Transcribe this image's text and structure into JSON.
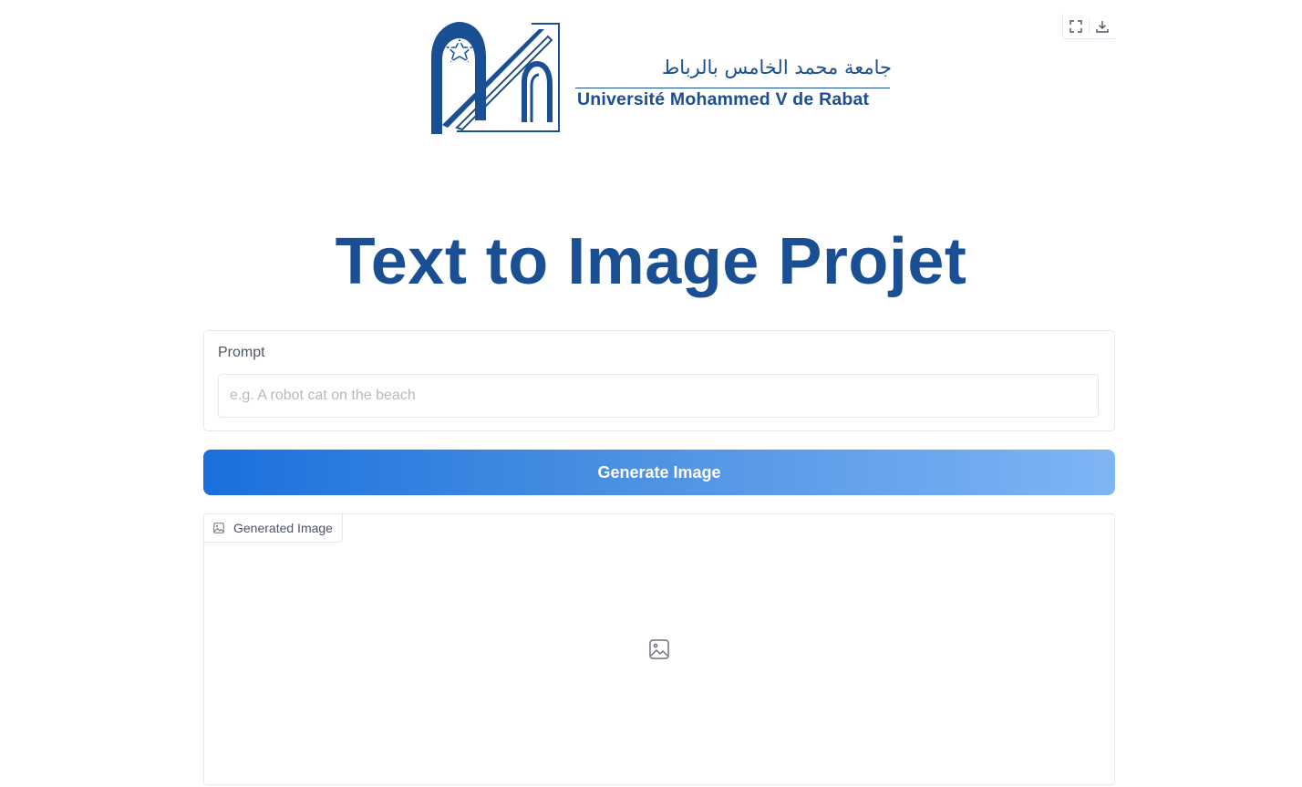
{
  "logo": {
    "arabic_text": "جامعة محمد الخامس بالرباط",
    "latin_text": "Université Mohammed V de Rabat",
    "icon": "university-arch-logo"
  },
  "image_toolbar": {
    "fullscreen_icon": "fullscreen-icon",
    "download_icon": "download-icon"
  },
  "title": "Text to Image Projet",
  "prompt": {
    "label": "Prompt",
    "value": "",
    "placeholder": "e.g. A robot cat on the beach"
  },
  "generate_button": {
    "label": "Generate Image"
  },
  "output": {
    "label": "Generated Image",
    "label_icon": "image-icon",
    "empty_icon": "image-placeholder-icon"
  },
  "colors": {
    "brand_blue": "#1a4f93",
    "button_gradient_start": "#1b6fdd",
    "button_gradient_end": "#7fb5f5",
    "border": "#e5e7eb"
  }
}
